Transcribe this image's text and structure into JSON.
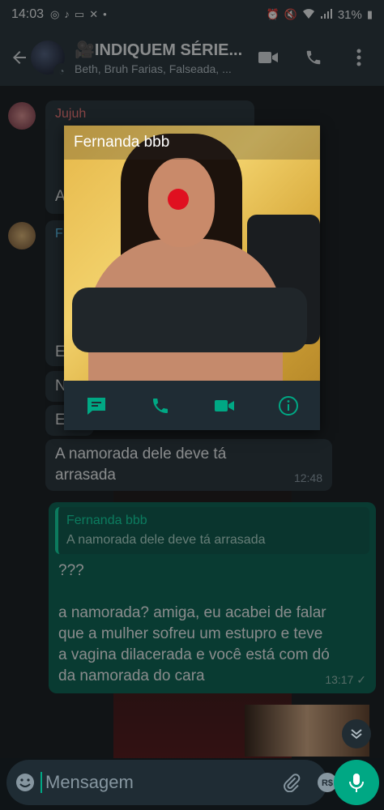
{
  "status_bar": {
    "time": "14:03",
    "battery": "31%"
  },
  "header": {
    "group_name": "🎥INDIQUEM SÉRIE...",
    "members": "Beth, Bruh Farias, Falseada, ..."
  },
  "messages": [
    {
      "sender": "Jujuh",
      "text_partial": "A"
    },
    {
      "sender": "F",
      "lines": [
        "E",
        "N",
        "E"
      ]
    },
    {
      "text": "A namorada dele deve tá arrasada",
      "time": "12:48"
    }
  ],
  "outgoing": {
    "quote_name": "Fernanda bbb",
    "quote_text": "A namorada dele deve tá arrasada",
    "text": "???\n\na namorada? amiga, eu acabei de falar que a mulher sofreu um estupro e teve a vagina dilacerada e  você está com dó da namorada do cara",
    "time": "13:17",
    "ticks": "✓"
  },
  "popup": {
    "contact_name": "Fernanda bbb"
  },
  "input": {
    "placeholder": "Mensagem"
  },
  "colors": {
    "accent": "#00a884",
    "outgoing_bubble": "#005c4b",
    "incoming_bubble": "#1f2c34"
  }
}
